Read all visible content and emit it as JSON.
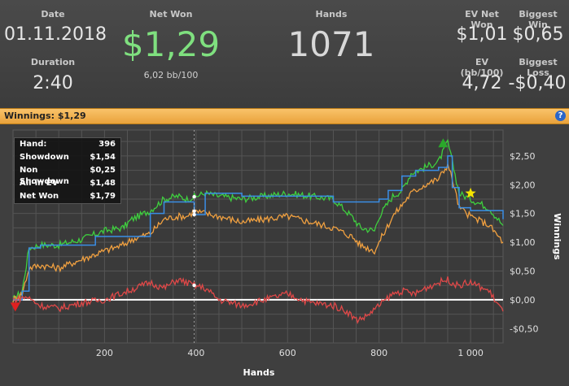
{
  "header": {
    "date_label": "Date",
    "date_value": "01.11.2018",
    "duration_label": "Duration",
    "duration_value": "2:40",
    "net_won_label": "Net Won",
    "net_won_value": "$1,29",
    "bb_per_100": "6,02 bb/100",
    "hands_label": "Hands",
    "hands_value": "1071",
    "ev_net_won_label": "EV Net Won",
    "ev_net_won_value": "$1,01",
    "biggest_win_label": "Biggest Win",
    "biggest_win_value": "$0,65",
    "ev_bb_label": "EV (bb/100)",
    "ev_bb_value": "4,72",
    "biggest_loss_label": "Biggest Loss",
    "biggest_loss_value": "-$0,40"
  },
  "bar": {
    "label": "Winnings:",
    "value": "$1,29",
    "help_icon": "?"
  },
  "tooltip": {
    "rows": [
      {
        "label": "Hand:",
        "value": "396"
      },
      {
        "label": "Showdown",
        "value": "$1,54"
      },
      {
        "label": "Non Showdown",
        "value": "$0,25"
      },
      {
        "label": "All-in EV",
        "value": "$1,48"
      },
      {
        "label": "Net Won",
        "value": "$1,79"
      }
    ]
  },
  "colors": {
    "net_won": "#3ecf3e",
    "showdown": "#f0a040",
    "non_showdown": "#e04848",
    "all_in_ev": "#3a8ee6",
    "zero_line": "#ffffff",
    "background": "#3a3a3a",
    "grid": "#555555"
  },
  "chart_data": {
    "type": "line",
    "xlabel": "Hands",
    "ylabel": "Winnings",
    "xlim": [
      0,
      1071
    ],
    "ylim": [
      -0.75,
      2.95
    ],
    "x_ticks": [
      200,
      400,
      600,
      800,
      1000
    ],
    "x_tick_labels": [
      "200",
      "400",
      "600",
      "800",
      "1 000"
    ],
    "y_ticks": [
      -0.5,
      0,
      0.5,
      1,
      1.5,
      2,
      2.5
    ],
    "y_tick_labels": [
      "-$0,50",
      "$0,00",
      "$0,50",
      "$1,00",
      "$1,50",
      "$2,00",
      "$2,50"
    ],
    "series": [
      {
        "name": "Net Won",
        "color": "#3ecf3e",
        "x": [
          0,
          20,
          35,
          60,
          100,
          150,
          200,
          240,
          260,
          300,
          330,
          360,
          380,
          396,
          420,
          450,
          500,
          550,
          600,
          650,
          700,
          740,
          760,
          790,
          800,
          830,
          850,
          870,
          900,
          930,
          950,
          960,
          975,
          1000,
          1040,
          1071
        ],
        "y": [
          0,
          0.15,
          0.9,
          0.95,
          0.95,
          1.05,
          1.2,
          1.25,
          1.4,
          1.55,
          1.75,
          1.8,
          1.75,
          1.79,
          1.85,
          1.8,
          1.75,
          1.8,
          1.85,
          1.8,
          1.75,
          1.45,
          1.25,
          1.2,
          1.45,
          1.8,
          1.9,
          2.2,
          2.3,
          2.4,
          2.75,
          2.4,
          1.85,
          1.75,
          1.6,
          1.29
        ]
      },
      {
        "name": "Showdown",
        "color": "#f0a040",
        "x": [
          0,
          20,
          35,
          60,
          100,
          150,
          200,
          240,
          260,
          300,
          330,
          360,
          380,
          396,
          420,
          450,
          500,
          550,
          600,
          650,
          700,
          740,
          760,
          790,
          800,
          830,
          850,
          870,
          900,
          930,
          950,
          960,
          975,
          1000,
          1040,
          1071
        ],
        "y": [
          0,
          0.1,
          0.55,
          0.6,
          0.55,
          0.7,
          0.85,
          0.95,
          1.05,
          1.15,
          1.4,
          1.45,
          1.45,
          1.54,
          1.5,
          1.45,
          1.35,
          1.4,
          1.45,
          1.35,
          1.25,
          1.1,
          0.95,
          0.85,
          1.0,
          1.45,
          1.65,
          1.85,
          2.0,
          2.1,
          2.35,
          2.1,
          1.6,
          1.45,
          1.3,
          1.0
        ]
      },
      {
        "name": "All-in EV",
        "color": "#3a8ee6",
        "x": [
          0,
          20,
          35,
          60,
          120,
          180,
          250,
          300,
          330,
          396,
          420,
          500,
          600,
          700,
          780,
          800,
          820,
          850,
          880,
          930,
          950,
          960,
          975,
          1000,
          1071
        ],
        "y": [
          0,
          0.15,
          0.9,
          0.95,
          0.95,
          1.1,
          1.1,
          1.5,
          1.7,
          1.48,
          1.85,
          1.8,
          1.8,
          1.7,
          1.7,
          1.75,
          1.9,
          2.15,
          2.25,
          2.3,
          2.5,
          1.95,
          1.6,
          1.55,
          1.4
        ]
      },
      {
        "name": "Non Showdown",
        "color": "#e04848",
        "x": [
          0,
          30,
          60,
          100,
          150,
          200,
          250,
          300,
          330,
          360,
          396,
          420,
          450,
          500,
          550,
          600,
          650,
          700,
          730,
          750,
          770,
          800,
          830,
          850,
          880,
          900,
          930,
          950,
          970,
          1000,
          1040,
          1071
        ],
        "y": [
          0,
          0.05,
          -0.1,
          -0.15,
          -0.05,
          0.0,
          0.15,
          0.3,
          0.2,
          0.35,
          0.25,
          0.2,
          0.0,
          -0.1,
          0.0,
          0.1,
          -0.05,
          -0.1,
          -0.2,
          -0.35,
          -0.3,
          -0.1,
          0.1,
          0.15,
          0.1,
          0.2,
          0.3,
          0.35,
          0.25,
          0.3,
          0.15,
          -0.2
        ]
      }
    ],
    "markers": [
      {
        "name": "Biggest Loss",
        "x": 5,
        "y": -0.12,
        "shape": "triangle-down",
        "color": "#e02020"
      },
      {
        "name": "Peak",
        "x": 940,
        "y": 2.72,
        "shape": "triangle-up",
        "color": "#2aa82a"
      },
      {
        "name": "EV Star",
        "x": 1000,
        "y": 1.85,
        "shape": "star",
        "color": "#f5e400"
      }
    ],
    "cursor_x": 396
  }
}
